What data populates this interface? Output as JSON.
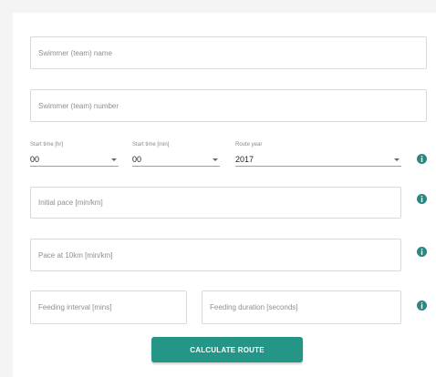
{
  "form": {
    "swimmer_name_placeholder": "Swimmer (team) name",
    "swimmer_number_placeholder": "Swimmer (team) number",
    "start_hour_label": "Start time [hr]",
    "start_hour_value": "00",
    "start_min_label": "Start time [min]",
    "start_min_value": "00",
    "route_year_label": "Route year",
    "route_year_value": "2017",
    "initial_pace_placeholder": "Initial pace [min/km]",
    "pace_10km_placeholder": "Pace at 10km [min/km]",
    "feeding_interval_placeholder": "Feeding interval [mins]",
    "feeding_duration_placeholder": "Feeding duration [seconds]",
    "calculate_label": "CALCULATE ROUTE"
  },
  "colors": {
    "accent": "#259587",
    "info_icon": "#27897f"
  },
  "icons": {
    "info": "info-icon"
  }
}
